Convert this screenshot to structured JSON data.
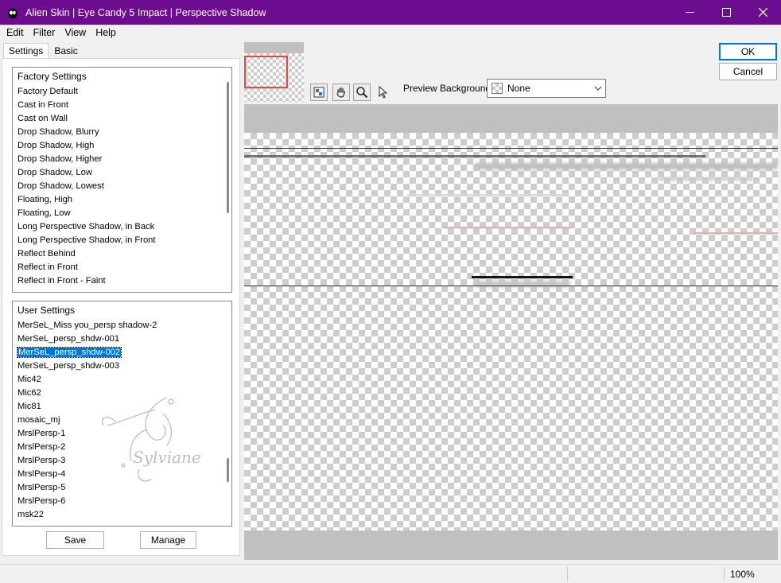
{
  "window": {
    "title": "Alien Skin | Eye Candy 5 Impact | Perspective Shadow",
    "minimize_icon": "minimize-icon",
    "maximize_icon": "maximize-icon",
    "close_icon": "close-icon"
  },
  "menu": [
    "Edit",
    "Filter",
    "View",
    "Help"
  ],
  "tabs": {
    "settings": "Settings",
    "basic": "Basic"
  },
  "factory": {
    "header": "Factory Settings",
    "items": [
      "Factory Default",
      "Cast in Front",
      "Cast on Wall",
      "Drop Shadow, Blurry",
      "Drop Shadow, High",
      "Drop Shadow, Higher",
      "Drop Shadow, Low",
      "Drop Shadow, Lowest",
      "Floating, High",
      "Floating, Low",
      "Long Perspective Shadow, in Back",
      "Long Perspective Shadow, in Front",
      "Reflect Behind",
      "Reflect in Front",
      "Reflect in Front - Faint"
    ]
  },
  "user": {
    "header": "User Settings",
    "selected": "MerSeL_persp_shdw-002",
    "items": [
      "MerSeL_Miss you_persp shadow-2",
      "MerSeL_persp_shdw-001",
      "MerSeL_persp_shdw-002",
      "MerSeL_persp_shdw-003",
      "Mic42",
      "Mic62",
      "Mic81",
      "mosaic_mj",
      "MrslPersp-1",
      "MrslPersp-2",
      "MrslPersp-3",
      "MrslPersp-4",
      "MrslPersp-5",
      "MrslPersp-6",
      "msk22"
    ]
  },
  "buttons": {
    "save": "Save",
    "manage": "Manage",
    "ok": "OK",
    "cancel": "Cancel"
  },
  "preview": {
    "background_label": "Preview Background:",
    "background_value": "None"
  },
  "watermark_text": "Sylviane",
  "status": {
    "zoom": "100%"
  },
  "colors": {
    "titlebar": "#6b0d8e",
    "selection": "#0078d7",
    "nav_rect": "#e84545"
  }
}
